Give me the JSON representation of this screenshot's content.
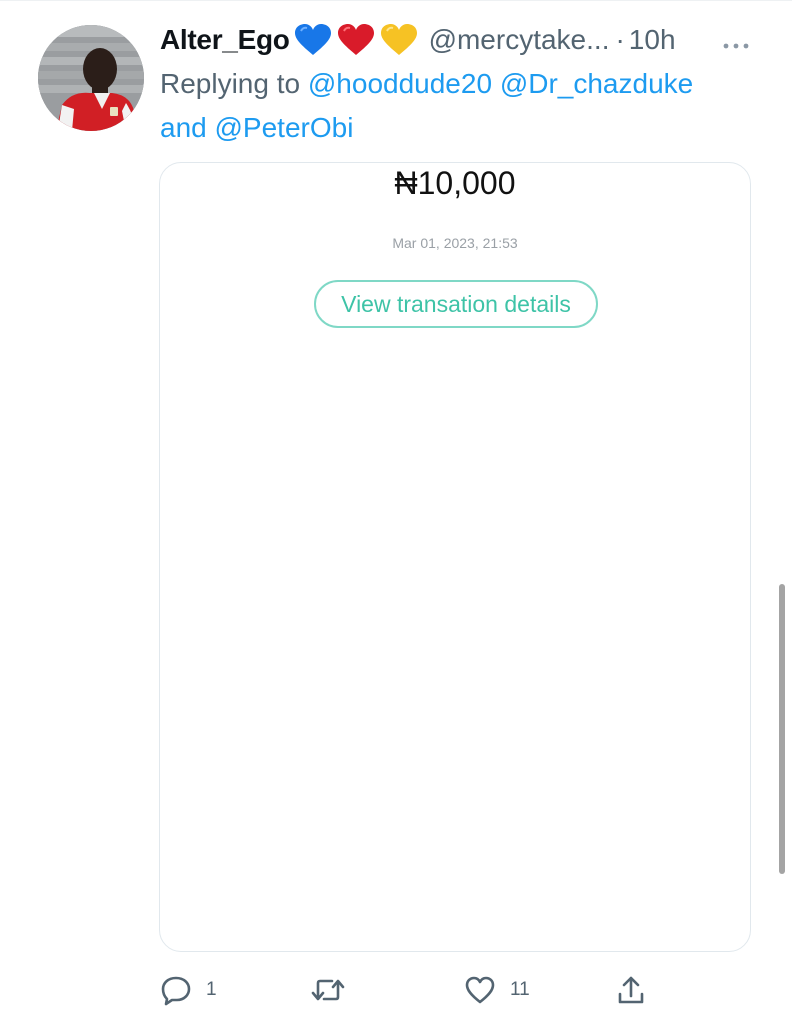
{
  "tweet": {
    "display_name": "Alter_Ego",
    "name_emojis": [
      {
        "icon": "blue-heart-emoji",
        "color": "#1877e8"
      },
      {
        "icon": "red-heart-emoji",
        "color": "#d91b2a"
      },
      {
        "icon": "yellow-heart-emoji",
        "color": "#f6c224"
      }
    ],
    "handle": "@mercytake...",
    "separator": "·",
    "time": "10h",
    "replying_prefix": "Replying to",
    "mentions": [
      "@hooddude20",
      "@Dr_chazduke",
      "@PeterObi"
    ],
    "and_word": "and",
    "more_icon": "more-horizontal-icon"
  },
  "receipt": {
    "amount": "₦10,000",
    "timestamp": "Mar 01, 2023, 21:53",
    "details_label": "View transation details",
    "accent_color": "#3ec3a7"
  },
  "actions": {
    "reply": {
      "icon": "reply-icon",
      "count": "1"
    },
    "retweet": {
      "icon": "retweet-icon",
      "count": ""
    },
    "like": {
      "icon": "like-icon",
      "count": "11"
    },
    "share": {
      "icon": "share-icon",
      "count": ""
    }
  },
  "colors": {
    "link": "#1d9bf0",
    "secondary_text": "#536471",
    "primary_text": "#0f1419"
  }
}
